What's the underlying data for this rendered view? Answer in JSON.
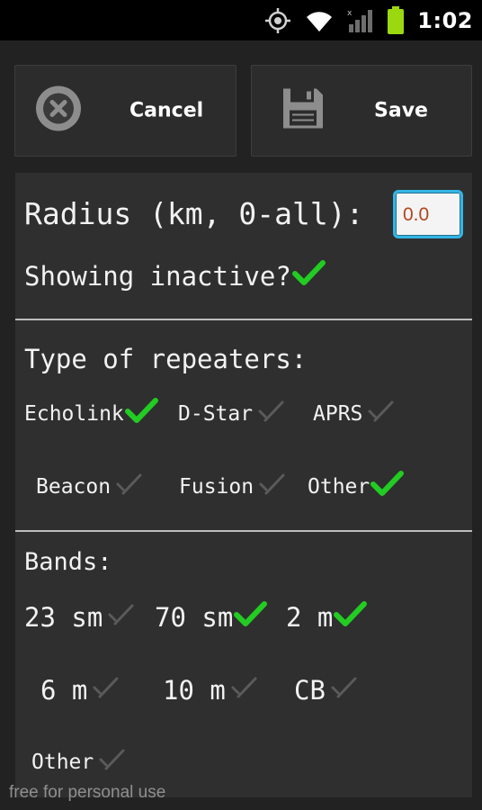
{
  "status_bar": {
    "time": "1:02",
    "icons": [
      "gps-icon",
      "wifi-icon",
      "signal-icon",
      "battery-icon"
    ],
    "battery_color": "#9cd80f"
  },
  "toolbar": {
    "cancel_label": "Cancel",
    "save_label": "Save"
  },
  "filters": {
    "radius_label": "Radius (km, 0-all):",
    "radius_value": "0.0",
    "showing_inactive_label": "Showing inactive?",
    "showing_inactive_checked": true
  },
  "repeater_types": {
    "heading": "Type of repeaters:",
    "items": [
      {
        "label": "Echolink",
        "checked": true
      },
      {
        "label": "D-Star",
        "checked": false
      },
      {
        "label": "APRS",
        "checked": false
      },
      {
        "label": "Beacon",
        "checked": false
      },
      {
        "label": "Fusion",
        "checked": false
      },
      {
        "label": "Other",
        "checked": true
      }
    ]
  },
  "bands": {
    "heading": "Bands:",
    "items": [
      {
        "label": "23 sm",
        "checked": false
      },
      {
        "label": "70 sm",
        "checked": true
      },
      {
        "label": "2 m",
        "checked": true
      },
      {
        "label": "6 m",
        "checked": false
      },
      {
        "label": "10 m",
        "checked": false
      },
      {
        "label": "CB",
        "checked": false
      },
      {
        "label": "Other",
        "checked": false
      }
    ]
  },
  "footer_note": "free for personal use",
  "colors": {
    "check_on": "#22cc22",
    "check_off": "#5a5a5a",
    "field_border": "#33b5e5",
    "field_text": "#b4441c"
  }
}
